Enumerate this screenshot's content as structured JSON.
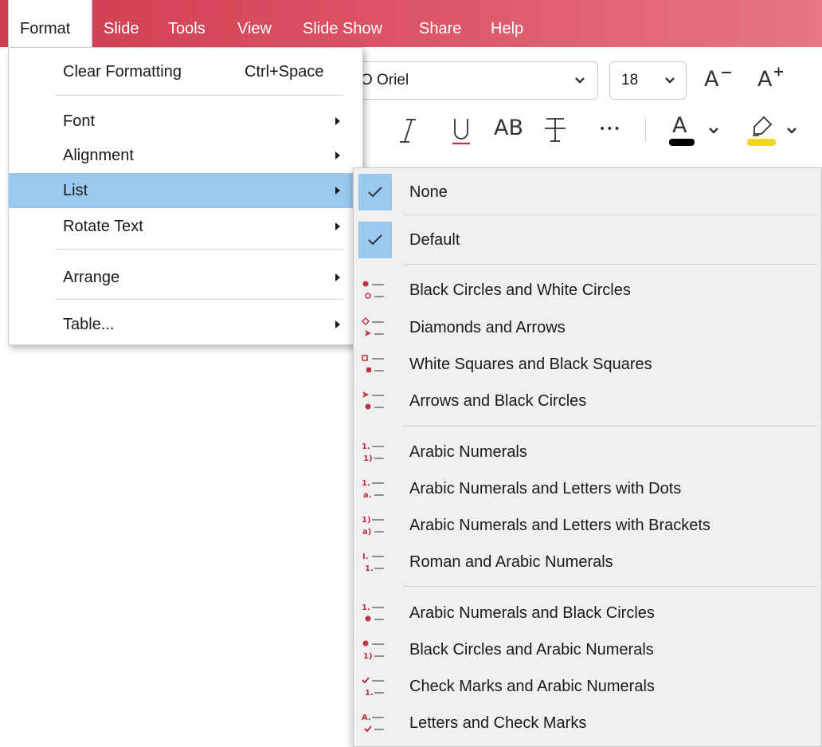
{
  "menubar": {
    "items": [
      "Format",
      "Slide",
      "Tools",
      "View",
      "Slide Show",
      "Share",
      "Help"
    ]
  },
  "toolbar": {
    "font_name": "O Oriel",
    "font_size": "18",
    "decrease_font_label": "A",
    "increase_font_label": "A",
    "uppercase_label": "AB",
    "more_label": "•••",
    "font_color_label": "A"
  },
  "format_menu": {
    "clear_formatting": "Clear Formatting",
    "clear_shortcut": "Ctrl+Space",
    "font": "Font",
    "alignment": "Alignment",
    "list": "List",
    "rotate_text": "Rotate Text",
    "arrange": "Arrange",
    "table": "Table..."
  },
  "list_menu": {
    "none": "None",
    "default": "Default",
    "items": [
      "Black Circles and White Circles",
      "Diamonds and Arrows",
      "White Squares and Black Squares",
      "Arrows and Black Circles",
      "Arabic Numerals",
      "Arabic Numerals and Letters with Dots",
      "Arabic Numerals and Letters with Brackets",
      "Roman and Arabic Numerals",
      "Arabic Numerals and Black Circles",
      "Black Circles and Arabic Numerals",
      "Check Marks and Arabic Numerals",
      "Letters and Check Marks"
    ],
    "icon_glyphs": [
      [
        "",
        ""
      ],
      [
        "",
        ""
      ],
      [
        "",
        ""
      ],
      [
        "",
        ""
      ],
      [
        "1.",
        "1)"
      ],
      [
        "1.",
        "a."
      ],
      [
        "1)",
        "a)"
      ],
      [
        "I.",
        "1."
      ],
      [
        "1.",
        ""
      ],
      [
        "",
        "1)"
      ],
      [
        "",
        "1."
      ],
      [
        "A.",
        ""
      ]
    ]
  },
  "colors": {
    "menubar_start": "#cf3c50",
    "menubar_end": "#e77683",
    "selection": "#99c9f1",
    "bullet_red": "#c0303f",
    "font_color_bar": "#000000",
    "highlight_bar": "#f2d622"
  }
}
